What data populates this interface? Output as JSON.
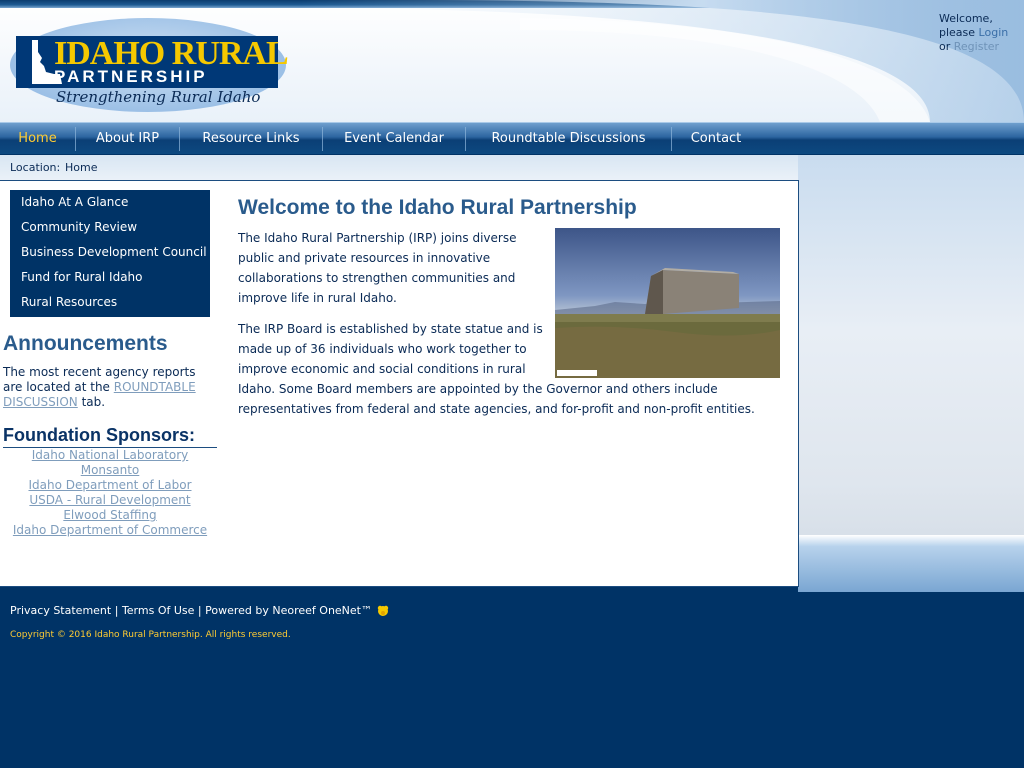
{
  "header": {
    "logo": {
      "line1": "IDAHO RURAL",
      "line2": "PARTNERSHIP",
      "tagline": "Strengthening Rural Idaho"
    },
    "welcome": {
      "line1": "Welcome,",
      "line2_prefix": "please",
      "login_label": "Login",
      "or": "or",
      "register_label": "Register"
    }
  },
  "nav": {
    "items": [
      {
        "label": "Home",
        "active": true
      },
      {
        "label": "About IRP"
      },
      {
        "label": "Resource Links"
      },
      {
        "label": "Event Calendar"
      },
      {
        "label": "Roundtable Discussions"
      },
      {
        "label": "Contact"
      }
    ]
  },
  "breadcrumb": {
    "prefix": "Location:",
    "current": "Home"
  },
  "left_menu": {
    "items": [
      {
        "label": "Idaho At A Glance"
      },
      {
        "label": "Community Review"
      },
      {
        "label": "Business Development Council"
      },
      {
        "label": "Fund for Rural Idaho"
      },
      {
        "label": "Rural Resources"
      }
    ]
  },
  "announcements": {
    "title": "Announcements",
    "text_before": "The most recent agency reports are located at the",
    "link_label": "ROUNDTABLE DISCUSSION",
    "text_after": "tab."
  },
  "sponsors": {
    "title": "Foundation Sponsors:",
    "items": [
      "Idaho National Laboratory",
      "Monsanto",
      "Idaho Department of Labor",
      "USDA - Rural Development",
      "Elwood Staffing",
      "Idaho Department of Commerce"
    ]
  },
  "main": {
    "title": "Welcome to the Idaho Rural Partnership",
    "paragraph1": "The Idaho Rural Partnership (IRP) joins diverse public and private resources in innovative collaborations to strengthen communities and improve life in rural Idaho.",
    "paragraph2_part1": "The IRP Board is established by state statue and is made up of 36 individuals who work together to improve economic and social conditions in rural",
    "paragraph2_part2": "Idaho. Some Board members are appointed by the Governor and others include representatives from federal and state agencies, and for-profit and non-profit entities."
  },
  "footer": {
    "privacy_label": "Privacy Statement",
    "separator": "|",
    "terms_label": "Terms Of Use",
    "powered_label": "Powered by Neoreef OneNet™",
    "copyright": "Copyright © 2016 Idaho Rural Partnership. All rights reserved."
  },
  "colors": {
    "brand_navy": "#003366",
    "logo_gold": "#f5c800",
    "heading_blue": "#2a5b8c",
    "nav_active": "#ffcc33",
    "link_muted": "#7f9dbc"
  }
}
